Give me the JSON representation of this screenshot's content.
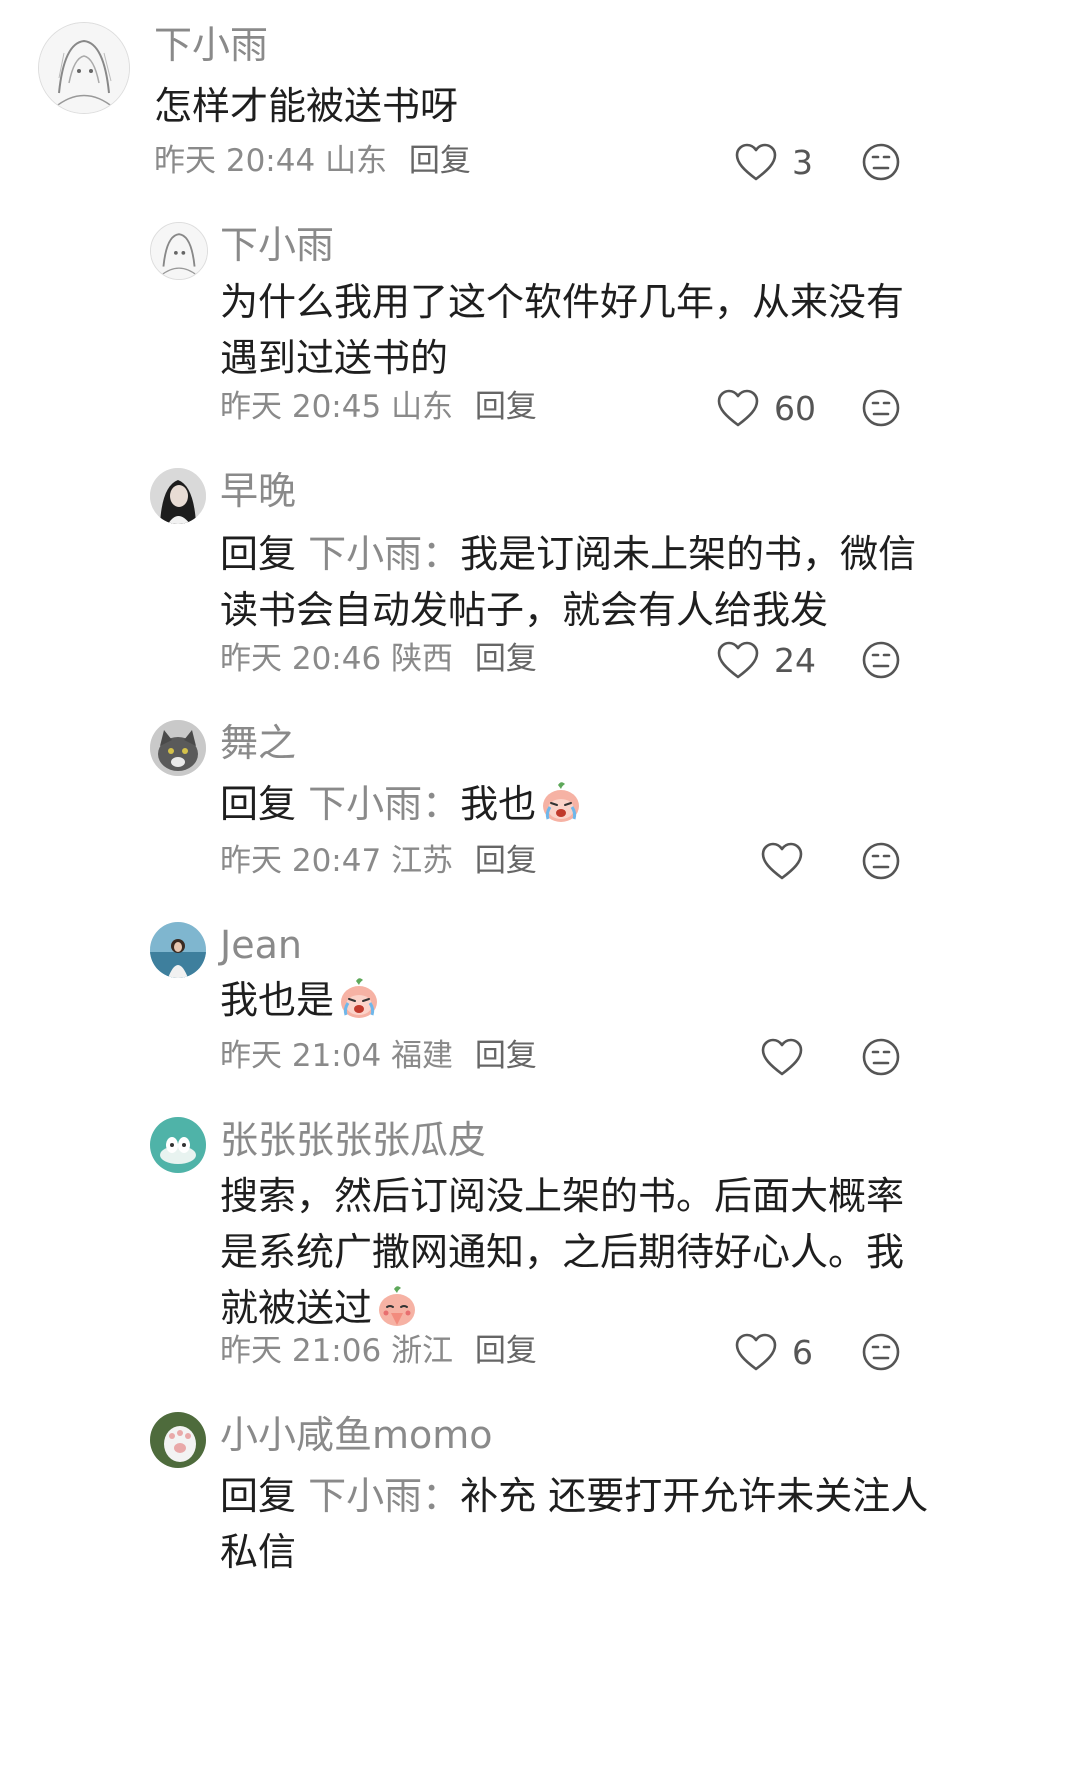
{
  "comments": [
    {
      "name": "下小雨",
      "text": "怎样才能被送书呀",
      "time": "昨天 20:44",
      "location": "山东",
      "reply_label": "回复",
      "likes": "3",
      "avatar": "sketch-girl-avatar"
    },
    {
      "name": "下小雨",
      "text_line1": "为什么我用了这个软件好几年，从来没有",
      "text_line2": "遇到过送书的",
      "time": "昨天 20:45",
      "location": "山东",
      "reply_label": "回复",
      "likes": "60",
      "avatar": "sketch-girl-avatar"
    },
    {
      "name": "早晚",
      "reply_prefix": "回复",
      "reply_target": "下小雨：",
      "text_line1": "我是订阅未上架的书，微信",
      "text_line2": "读书会自动发帖子，就会有人给我发",
      "time": "昨天 20:46",
      "location": "陕西",
      "reply_label": "回复",
      "likes": "24",
      "avatar": "woman-portrait-avatar"
    },
    {
      "name": "舞之",
      "reply_prefix": "回复",
      "reply_target": "下小雨：",
      "text": "我也",
      "emoji": "crying-face-emoji",
      "time": "昨天 20:47",
      "location": "江苏",
      "reply_label": "回复",
      "likes": "",
      "avatar": "cat-avatar"
    },
    {
      "name": "Jean",
      "text": "我也是",
      "emoji": "crying-face-emoji",
      "time": "昨天 21:04",
      "location": "福建",
      "reply_label": "回复",
      "likes": "",
      "avatar": "seaside-person-avatar"
    },
    {
      "name": "张张张张张瓜皮",
      "text_line1": "搜索，然后订阅没上架的书。后面大概率",
      "text_line2": "是系统广撒网通知，之后期待好心人。我",
      "text_line3": "就被送过",
      "emoji": "praying-face-emoji",
      "time": "昨天 21:06",
      "location": "浙江",
      "reply_label": "回复",
      "likes": "6",
      "avatar": "green-cartoon-avatar"
    },
    {
      "name": "小小咸鱼momo",
      "reply_prefix": "回复",
      "reply_target": "下小雨：",
      "text_line1": "补充 还要打开允许未关注人",
      "text_line2": "私信",
      "avatar": "paw-avatar"
    }
  ],
  "colors": {
    "name": "#8a8a8a",
    "text": "#1e1e1e",
    "meta": "#8a8a8a",
    "icon": "#555555"
  }
}
